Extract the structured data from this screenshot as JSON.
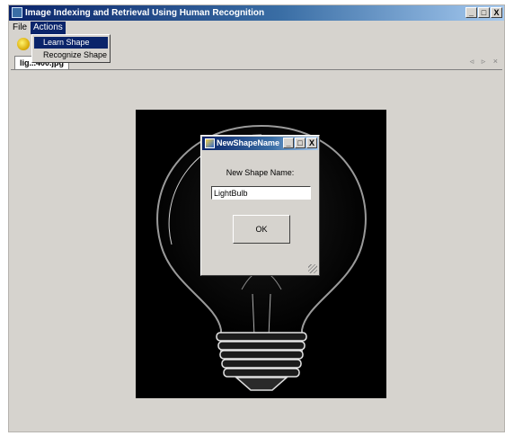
{
  "app": {
    "title": "Image Indexing and Retrieval Using Human Recognition"
  },
  "window_controls": {
    "minimize": "_",
    "maximize": "□",
    "close": "X"
  },
  "menubar": {
    "file": "File",
    "actions": "Actions"
  },
  "actions_menu": {
    "items": [
      "Learn Shape",
      "Recognize Shape"
    ],
    "selected": "Learn Shape"
  },
  "tab": {
    "label": "lig...400.jpg",
    "nav": "◃ ▹ ×"
  },
  "dialog": {
    "title": "NewShapeName",
    "prompt": "New Shape Name:",
    "input_value": "LightBulb",
    "ok_label": "OK"
  }
}
